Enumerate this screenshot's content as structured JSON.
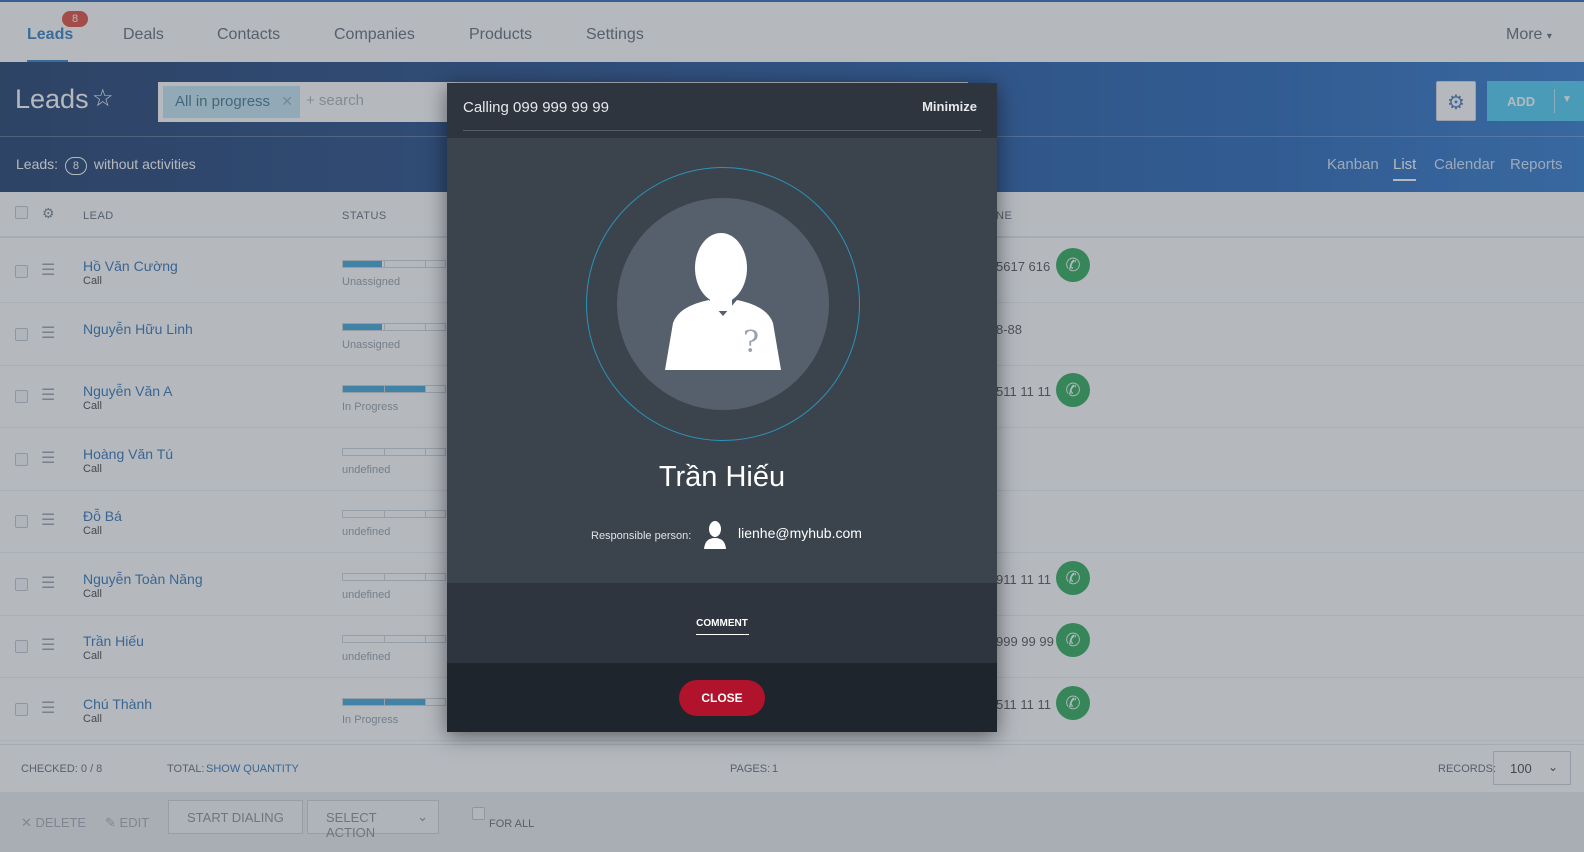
{
  "topnav": {
    "items": [
      "Leads",
      "Deals",
      "Contacts",
      "Companies",
      "Products",
      "Settings"
    ],
    "leads_badge": "8",
    "more": "More"
  },
  "header": {
    "title": "Leads",
    "filter_tag": "All in progress",
    "search_placeholder": "+ search",
    "add_label": "ADD",
    "leads_label": "Leads:",
    "leads_count": "8",
    "without_activities": "without activities",
    "views": [
      "Kanban",
      "List",
      "Calendar",
      "Reports"
    ],
    "active_view": "List"
  },
  "grid": {
    "columns": [
      "LEAD",
      "STATUS",
      "NE"
    ],
    "rows": [
      {
        "name": "Hồ Văn Cường",
        "sub": "Call",
        "status": "Unassigned",
        "progress": 0.38,
        "phone": "5617 616",
        "call": true
      },
      {
        "name": "Nguyễn Hữu Linh",
        "sub": "",
        "status": "Unassigned",
        "progress": 0.38,
        "phone": "8-88",
        "call": false
      },
      {
        "name": "Nguyễn Văn A",
        "sub": "Call",
        "status": "In Progress",
        "progress": 0.8,
        "phone": "511 11 11",
        "call": true
      },
      {
        "name": "Hoàng Văn Tú",
        "sub": "Call",
        "status": "undefined",
        "progress": 0,
        "phone": "",
        "call": false
      },
      {
        "name": "Đỗ Bá",
        "sub": "Call",
        "status": "undefined",
        "progress": 0,
        "phone": "",
        "call": false
      },
      {
        "name": "Nguyễn Toàn Năng",
        "sub": "Call",
        "status": "undefined",
        "progress": 0,
        "phone": "911 11 11",
        "call": true
      },
      {
        "name": "Trần Hiếu",
        "sub": "Call",
        "status": "undefined",
        "progress": 0,
        "phone": "999 99 99",
        "call": true
      },
      {
        "name": "Chú Thành",
        "sub": "Call",
        "status": "In Progress",
        "progress": 0.8,
        "phone": "511 11 11",
        "call": true
      }
    ]
  },
  "footer": {
    "checked_label": "CHECKED: 0 / 8",
    "total_label": "TOTAL:",
    "show_quantity": "SHOW QUANTITY",
    "pages_label": "PAGES:",
    "pages_value": "1",
    "records_label": "RECORDS:",
    "records_value": "100",
    "delete": "DELETE",
    "edit": "EDIT",
    "start_dialing": "START DIALING",
    "select_action": "SELECT ACTION",
    "for_all": "FOR ALL"
  },
  "dialog": {
    "title": "Calling 099 999 99 99",
    "minimize": "Minimize",
    "person_name": "Trần Hiếu",
    "responsible_label": "Responsible person:",
    "responsible_email": "lienhe@myhub.com",
    "comment_tab": "COMMENT",
    "close": "CLOSE"
  },
  "colors": {
    "accent": "#1e73be",
    "call_green": "#19a34a",
    "close_red": "#b0132b",
    "add_blue": "#3bc8f5"
  }
}
